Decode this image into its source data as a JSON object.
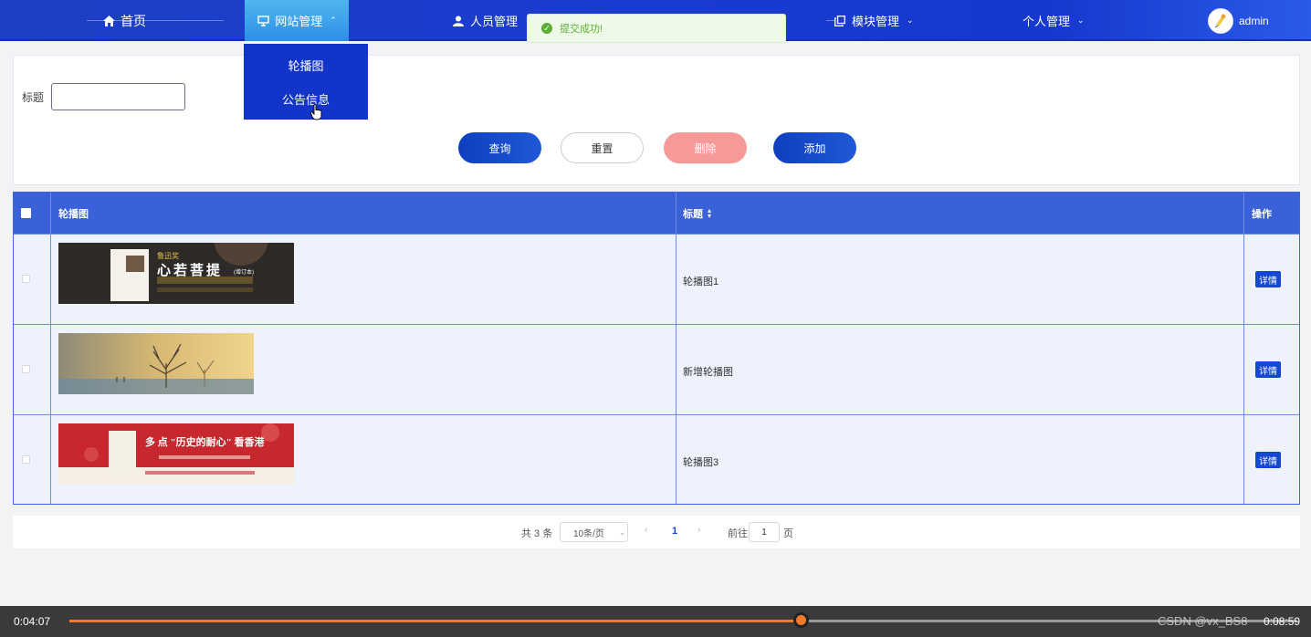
{
  "nav": {
    "home": "首页",
    "website": "网站管理",
    "people": "人员管理",
    "modules": "模块管理",
    "personal": "个人管理",
    "user": "admin"
  },
  "dropdown": {
    "items": [
      "轮播图",
      "公告信息"
    ]
  },
  "toast": {
    "text": "提交成功!"
  },
  "search": {
    "title_label": "标题",
    "title_value": "",
    "buttons": {
      "query": "查询",
      "reset": "重置",
      "delete": "删除",
      "add": "添加"
    }
  },
  "table": {
    "headers": {
      "image": "轮播图",
      "title": "标题",
      "actions": "操作"
    },
    "rows": [
      {
        "title": "轮播图1",
        "action": "详情"
      },
      {
        "title": "新增轮播图",
        "action": "详情"
      },
      {
        "title": "轮播图3",
        "action": "详情"
      }
    ]
  },
  "banner1": {
    "tag": "鲁迅奖",
    "name": "心若菩提",
    "sub": "(增订本)"
  },
  "banner3": {
    "headline": "多 点 \"历史的耐心\" 看香港"
  },
  "pager": {
    "total": "共 3 条",
    "page_size": "10条/页",
    "current": "1",
    "goto_label": "前往",
    "goto_value": "1",
    "page_label": "页"
  },
  "video": {
    "elapsed": "0:04:07",
    "duration": "0:08:59",
    "watermark": "CSDN @vx_BS8",
    "progress": 0.596
  },
  "colors": {
    "nav_bg": "#1e3fc4",
    "primary": "#1447d2",
    "danger": "#f59a98",
    "success": "#5daf34",
    "progress": "#f07a2c"
  }
}
